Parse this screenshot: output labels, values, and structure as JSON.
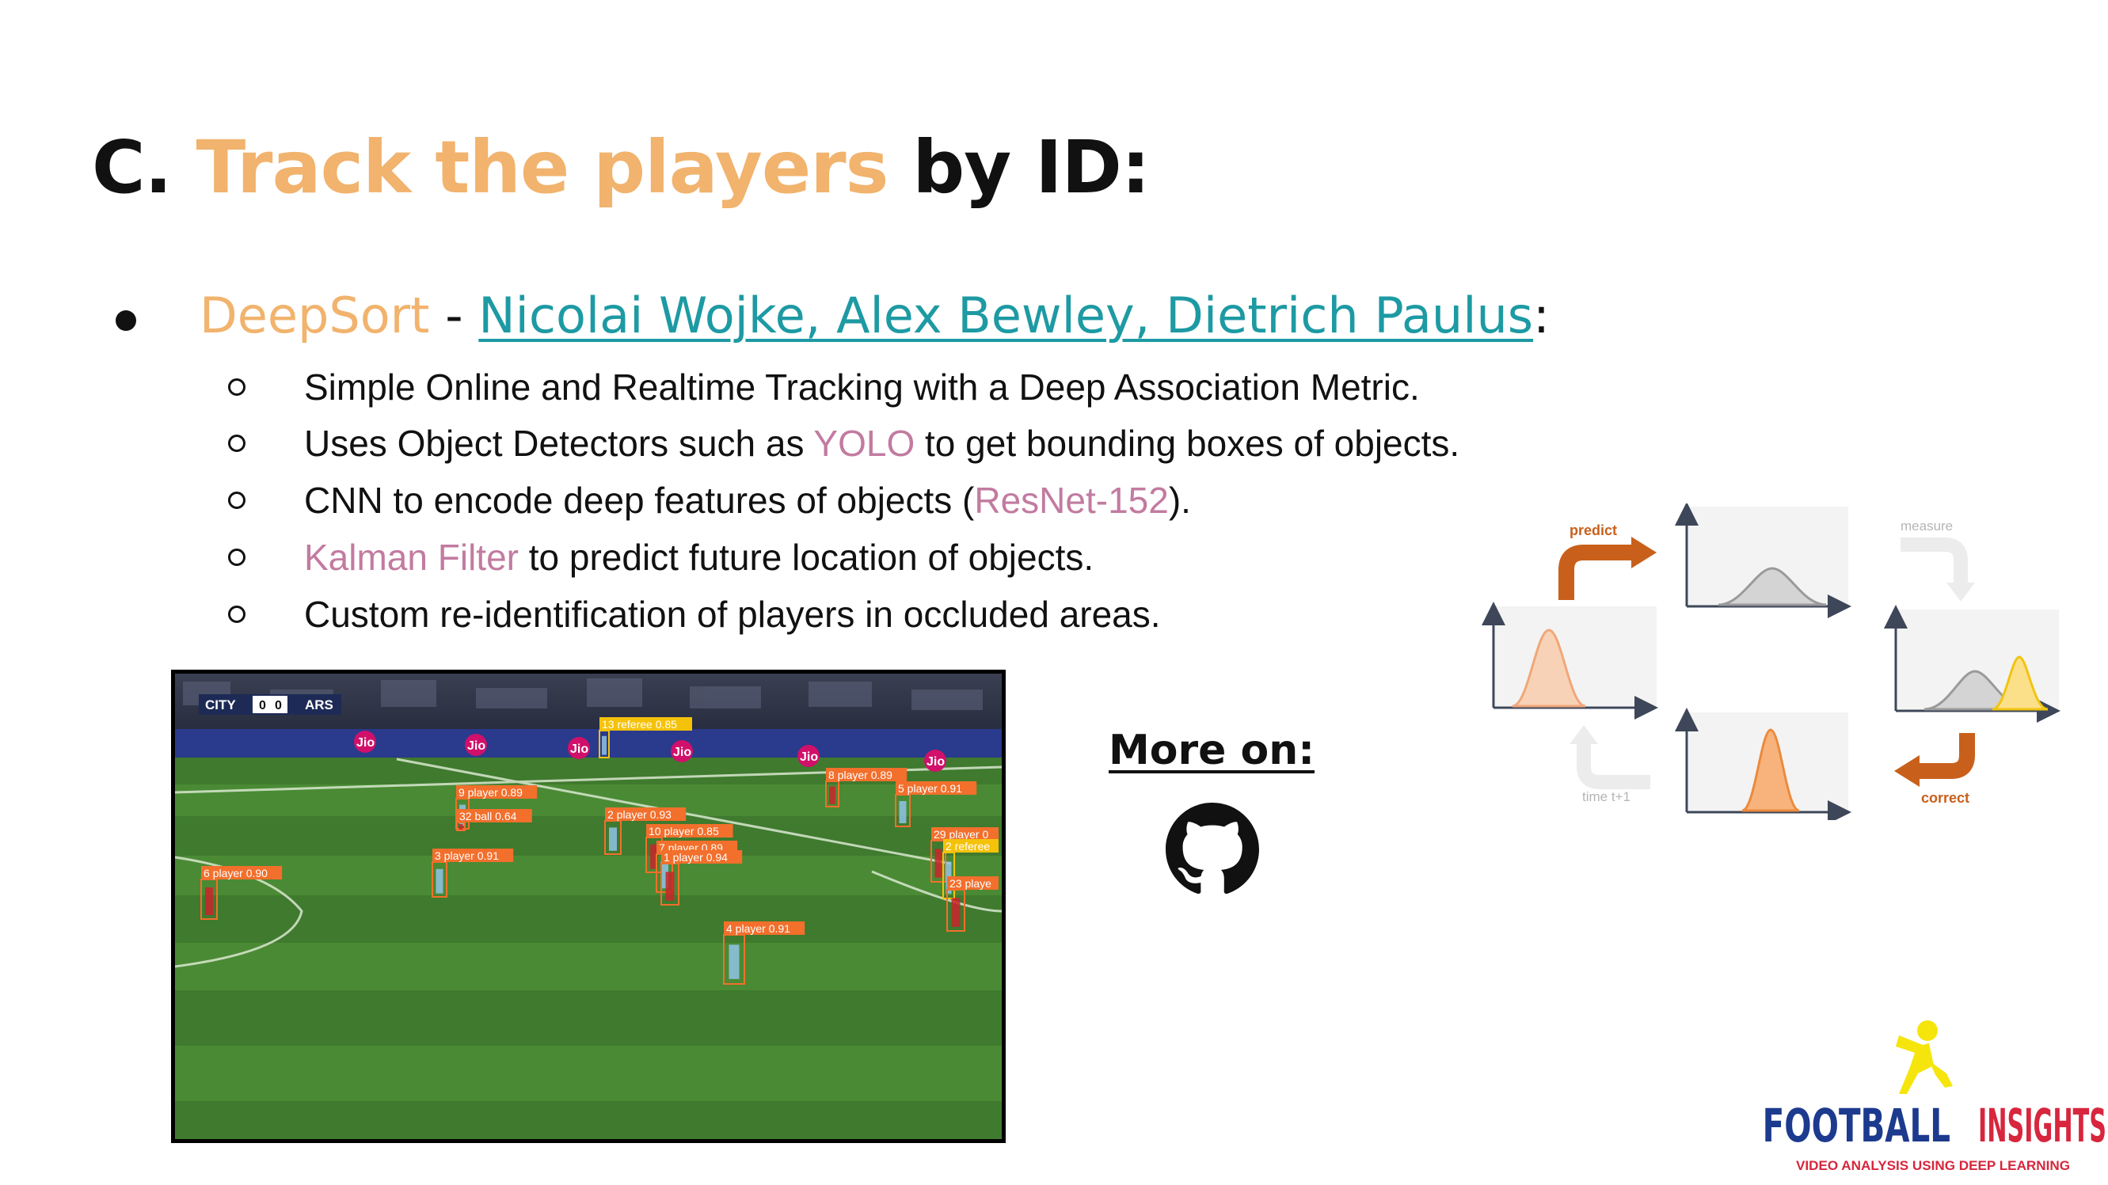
{
  "slide": {
    "title_prefix": "C. ",
    "title_accent": "Track the players",
    "title_suffix": " by ID:",
    "colors": {
      "accent": "#f1b36d",
      "link": "#1d9aa3",
      "highlight": "#c27ba0"
    }
  },
  "bullet": {
    "name": "DeepSort",
    "separator": " - ",
    "authors": "Nicolai Wojke, Alex Bewley, Dietrich Paulus",
    "colon": ":"
  },
  "subbullets": [
    {
      "pre": "Simple Online and Realtime Tracking with a Deep Association Metric.",
      "hl": "",
      "post": ""
    },
    {
      "pre": "Uses Object Detectors such as ",
      "hl": "YOLO",
      "post": " to get bounding boxes of objects."
    },
    {
      "pre": "CNN to encode deep features of objects (",
      "hl": "ResNet-152",
      "post": ")."
    },
    {
      "pre": "",
      "hl": "Kalman Filter",
      "post": " to predict future location of objects."
    },
    {
      "pre": "Custom re-identification of players in occluded areas.",
      "hl": "",
      "post": ""
    }
  ],
  "video": {
    "scoreboard": {
      "home": "CITY",
      "home_score": "0",
      "away_score": "0",
      "away": "ARS"
    },
    "sponsor": "Jio",
    "detections": [
      {
        "label": "9 player 0.89"
      },
      {
        "label": "32 ball 0.64"
      },
      {
        "label": "2 player 0.93"
      },
      {
        "label": "10 player 0.85"
      },
      {
        "label": "7 player 0.89"
      },
      {
        "label": "1 player 0.94"
      },
      {
        "label": "3 player 0.91"
      },
      {
        "label": "6 player 0.90"
      },
      {
        "label": "4 player 0.91"
      },
      {
        "label": "29 player 0"
      },
      {
        "label": "2 referee"
      },
      {
        "label": "23 playe"
      },
      {
        "label": "5 player 0.91"
      },
      {
        "label": "8 player 0.89"
      },
      {
        "label": "13 referee 0.85"
      }
    ]
  },
  "more": {
    "label": "More on:",
    "icon": "github-icon"
  },
  "kalman": {
    "predict": "predict",
    "measure": "measure",
    "correct": "correct",
    "time": "time t+1"
  },
  "logo": {
    "word1": "FOOTBALL",
    "word2": "INSIGHTS",
    "tagline": "VIDEO ANALYSIS USING DEEP LEARNING"
  }
}
